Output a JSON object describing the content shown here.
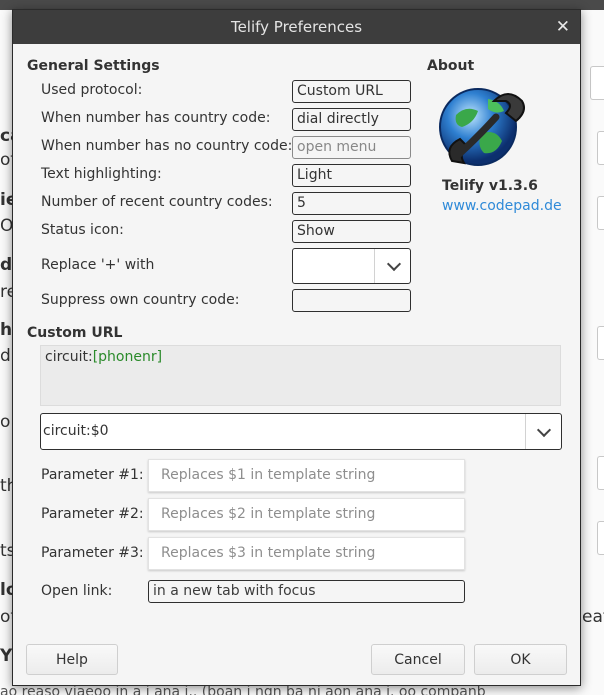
{
  "dialog": {
    "title": "Telify Preferences",
    "close_glyph": "✕"
  },
  "general": {
    "title": "General Settings",
    "rows": [
      {
        "label": "Used protocol:",
        "value": "Custom URL"
      },
      {
        "label": "When number has country code:",
        "value": "dial directly"
      },
      {
        "label": "When number has no country code:",
        "value": "open menu"
      },
      {
        "label": "Text highlighting:",
        "value": "Light"
      },
      {
        "label": "Number of recent country codes:",
        "value": "5"
      },
      {
        "label": "Status icon:",
        "value": "Show"
      }
    ],
    "replace_plus_label": "Replace '+' with",
    "replace_plus_value": "",
    "suppress_label": "Suppress own country code:",
    "suppress_value": ""
  },
  "about": {
    "title": "About",
    "version": "Telify v1.3.6",
    "website": "www.codepad.de",
    "logo_icon": "globe-phone-icon"
  },
  "custom_url": {
    "title": "Custom URL",
    "template_prefix": "circuit:",
    "template_placeholder": "[phonenr]",
    "combo_value": "circuit:$0",
    "params": [
      {
        "label": "Parameter #1:",
        "placeholder": "Replaces $1 in template string"
      },
      {
        "label": "Parameter #2:",
        "placeholder": "Replaces $2 in template string"
      },
      {
        "label": "Parameter #3:",
        "placeholder": "Replaces $3 in template string"
      }
    ],
    "open_link_label": "Open link:",
    "open_link_value": "in a new tab with focus"
  },
  "buttons": {
    "help": "Help",
    "cancel": "Cancel",
    "ok": "OK"
  },
  "background": {
    "fragments": [
      "ca",
      "of",
      "ie",
      "O",
      "d",
      "re",
      "he",
      "d",
      "o",
      "th",
      "ts",
      "lo",
      "ot",
      "Y",
      "eat."
    ],
    "bottom_text": "ao reaso viaeoo in a i ana i.. (boan i ngn ba ni aon ana i. oo companb"
  },
  "colors": {
    "titlebar": "#3d3d3d",
    "link": "#2f8ad8",
    "template_green": "#2a8a2a"
  }
}
